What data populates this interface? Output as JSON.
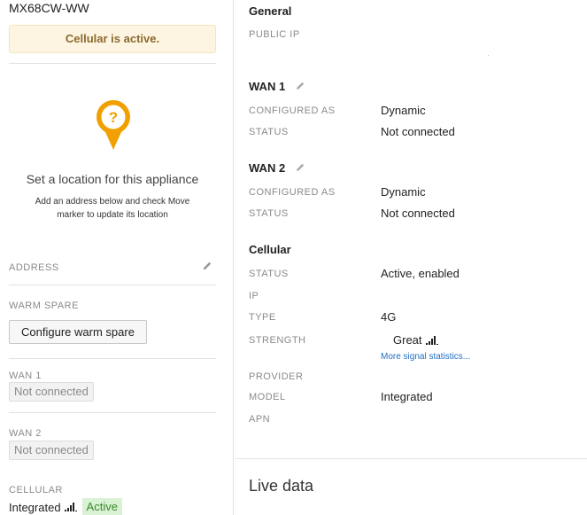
{
  "device": {
    "name": "MX68CW-WW"
  },
  "banner": {
    "text": "Cellular is active.",
    "bg_color": "#fdf5e1",
    "text_color": "#8a6a2e"
  },
  "location": {
    "icon": "location-pin-question-icon",
    "accent_color": "#f0a000",
    "title": "Set a location for this appliance",
    "subtitle_line1": "Add an address below and check Move",
    "subtitle_line2": "marker to update its location"
  },
  "sidebar": {
    "address_label": "ADDRESS",
    "warm_spare_label": "WARM SPARE",
    "warm_spare_button": "Configure warm spare",
    "wan1_label": "WAN 1",
    "wan1_status": "Not connected",
    "wan2_label": "WAN 2",
    "wan2_status": "Not connected",
    "cellular_label": "CELLULAR",
    "cellular_model": "Integrated",
    "cellular_signal_bars": "4 of 5",
    "cellular_status": "Active",
    "active_color": "#3a8a2e"
  },
  "general": {
    "title": "General",
    "public_ip_label": "PUBLIC IP",
    "public_ip_value": ""
  },
  "wan1": {
    "title": "WAN 1",
    "configured_as_label": "CONFIGURED AS",
    "configured_as_value": "Dynamic",
    "status_label": "STATUS",
    "status_value": "Not connected"
  },
  "wan2": {
    "title": "WAN 2",
    "configured_as_label": "CONFIGURED AS",
    "configured_as_value": "Dynamic",
    "status_label": "STATUS",
    "status_value": "Not connected"
  },
  "cellular": {
    "title": "Cellular",
    "status_label": "STATUS",
    "status_value": "Active, enabled",
    "ip_label": "IP",
    "ip_value": "",
    "type_label": "TYPE",
    "type_value": "4G",
    "strength_label": "STRENGTH",
    "strength_value": "Great",
    "strength_bars": "4 of 5",
    "more_stats_link": "More signal statistics...",
    "provider_label": "PROVIDER",
    "provider_value": "",
    "model_label": "MODEL",
    "model_value": "Integrated",
    "apn_label": "APN",
    "apn_value": "",
    "link_color": "#1f6fc5"
  },
  "live_data": {
    "title": "Live data"
  }
}
